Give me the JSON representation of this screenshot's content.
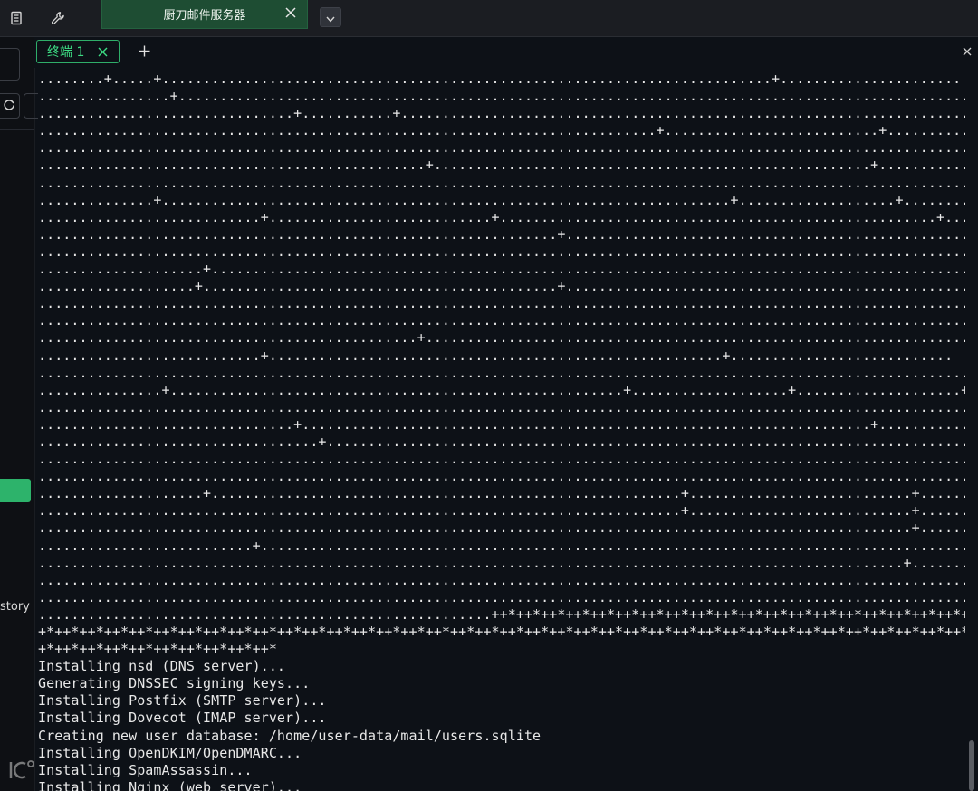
{
  "topbar": {
    "list_icon": "list-icon",
    "wrench_icon": "wrench-icon",
    "active_tab": {
      "label": "厨刀邮件服务器"
    },
    "dropdown_icon": "chevron-down-icon",
    "tab_color": "#1e4d33"
  },
  "sidebar": {
    "history_label": "story",
    "accent_color": "#2db36b"
  },
  "terminal_tabs": {
    "tabs": [
      {
        "label": "终端 1"
      }
    ],
    "add_label": "+",
    "accent_color": "#3ddc84"
  },
  "terminal": {
    "lines": [
      "........+.....+..........................................................................+......................",
      "................+.................................................................................................",
      "...............................+...........+......................................................................",
      "...........................................................................+..........................+...........",
      "..................................................................................................................",
      "...............................................+.....................................................+............",
      "..................................................................................................................",
      "..............+.....................................................................+...................+.........",
      "...........................+...........................+.....................................................+....",
      "...............................................................+..................................................",
      "..................................................................................................................",
      "....................+.............................................................................................",
      "...................+...........................................+..................................................",
      "..................................................................................................................",
      "..................................................................................................................",
      "..............................................+...................................................................",
      "...........................+.......................................................+...........................",
      "..................................................................................................................",
      "...............+.......................................................+...................+....................+.",
      "..................................................................................................................",
      "...............................+.....................................................................+............",
      "..................................+...............................................................................",
      "..................................................................................................................",
      "..................................................................................................................",
      "....................+.........................................................+...........................+.......",
      "..............................................................................+...........................+........",
      "..........................................................................................................+.......",
      "..........................+.......................................................................................",
      ".........................................................................................................+........",
      "..................................................................................................................",
      "..................................................................................................................",
      ".......................................................++*++*++*++*++*++*++*++*++*++*++*++*++*++*++*++*++*++*++*++*+",
      "+*++*++*++*++*++*++*++*++*++*++*++*++*++*++*++*++*++*++*++*++*++*++*++*++*++*++*++*++*++*++*++*++*++*++*++*++*++*+",
      "+*++*++*++*++*++*++*++*++*++*",
      "Installing nsd (DNS server)...",
      "Generating DNSSEC signing keys...",
      "Installing Postfix (SMTP server)...",
      "Installing Dovecot (IMAP server)...",
      "Creating new user database: /home/user-data/mail/users.sqlite",
      "Installing OpenDKIM/OpenDMARC...",
      "Installing SpamAssassin...",
      "Installing Nginx (web server)..."
    ],
    "text_color": "#e8e8e8",
    "background": "#0d1117"
  }
}
